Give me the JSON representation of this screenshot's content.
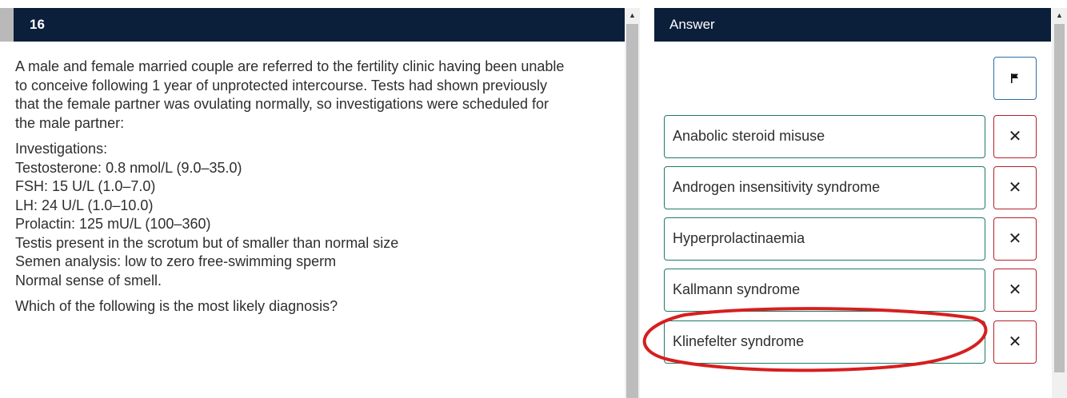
{
  "question": {
    "number": "16",
    "intro_lines": [
      "A male and female married couple are referred to the fertility clinic having been unable",
      "to conceive following 1 year of unprotected intercourse. Tests had shown previously",
      "that the female partner was ovulating normally, so investigations were scheduled for",
      "the male partner:"
    ],
    "investigation_lines": [
      "Investigations:",
      "Testosterone: 0.8 nmol/L (9.0–35.0)",
      "FSH: 15 U/L (1.0–7.0)",
      "LH: 24 U/L (1.0–10.0)",
      "Prolactin: 125 mU/L (100–360)",
      "Testis present in the scrotum but of smaller than normal size",
      "Semen analysis: low to zero free-swimming sperm",
      "Normal sense of smell."
    ],
    "prompt": "Which of the following is the most likely diagnosis?"
  },
  "answer": {
    "header": "Answer",
    "flag_icon": "flag-icon",
    "options": [
      "Anabolic steroid misuse",
      "Androgen insensitivity syndrome",
      "Hyperprolactinaemia",
      "Kallmann syndrome",
      "Klinefelter syndrome"
    ],
    "eliminate_symbol": "✕",
    "highlighted_option": "Klinefelter syndrome"
  },
  "colors": {
    "header_bg": "#0b1f3a",
    "option_border": "#1e7a68",
    "eliminate_border": "#b3222a",
    "flag_border": "#2d6ea8",
    "annotation": "#d61f1f"
  },
  "scrollbar_arrow": "▲"
}
